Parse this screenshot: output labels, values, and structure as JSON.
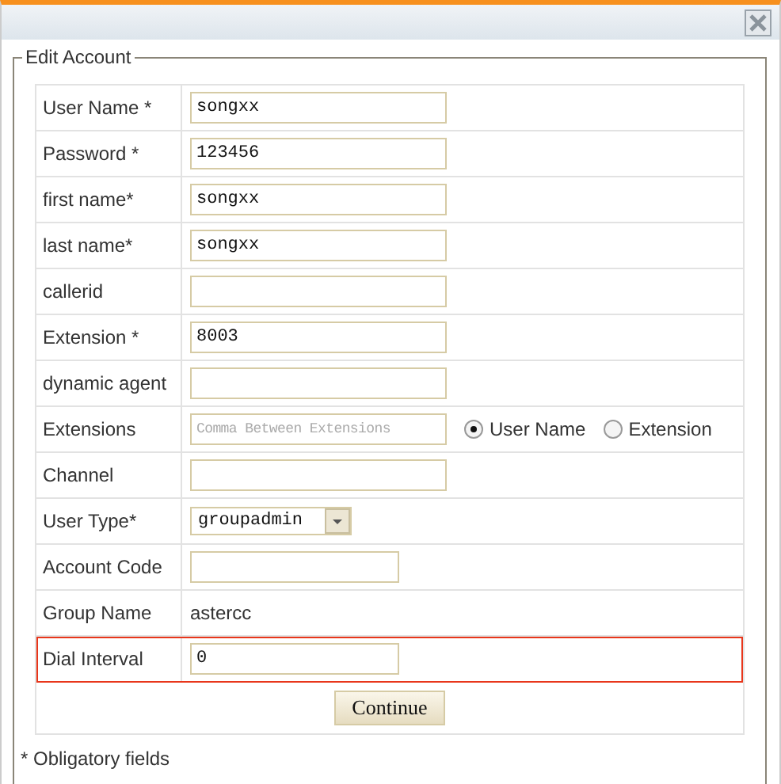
{
  "legend": "Edit Account",
  "rows": [
    {
      "kind": "input",
      "label": "User Name *",
      "value": "songxx",
      "highlighted": false
    },
    {
      "kind": "input",
      "label": "Password *",
      "value": "123456",
      "highlighted": false
    },
    {
      "kind": "input",
      "label": "first name*",
      "value": "songxx",
      "highlighted": false
    },
    {
      "kind": "input",
      "label": "last name*",
      "value": "songxx",
      "highlighted": false
    },
    {
      "kind": "input",
      "label": "callerid",
      "highlighted": false
    },
    {
      "kind": "input",
      "label": "Extension *",
      "value": "8003",
      "highlighted": false
    },
    {
      "kind": "input",
      "label": "dynamic agent",
      "highlighted": false
    },
    {
      "kind": "input",
      "label": "Extensions",
      "placeholder": "Comma Between Extensions",
      "highlighted": false,
      "options": [
        {
          "label": "User Name",
          "selected": true
        },
        {
          "label": "Extension",
          "selected": false
        }
      ]
    },
    {
      "kind": "input",
      "label": "Channel",
      "highlighted": false
    },
    {
      "kind": "select",
      "label": "User Type*",
      "value": "groupadmin",
      "highlighted": false
    },
    {
      "kind": "short-input",
      "label": "Account Code",
      "highlighted": false
    },
    {
      "kind": "text",
      "label": "Group Name",
      "value": "astercc",
      "highlighted": false
    },
    {
      "kind": "short-input",
      "label": "Dial Interval",
      "value": "0",
      "highlighted": true
    }
  ],
  "button": "Continue",
  "footnote": "* Obligatory fields"
}
